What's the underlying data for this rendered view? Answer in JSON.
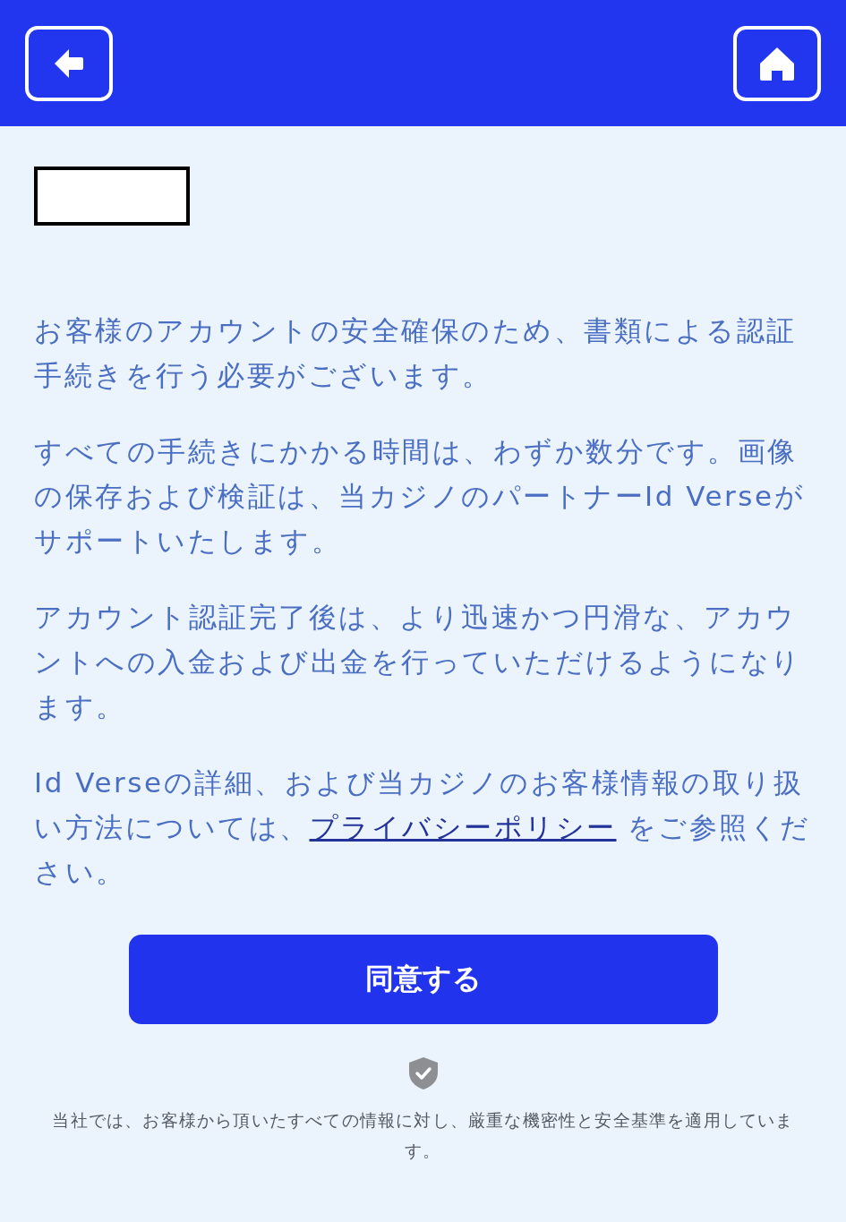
{
  "paragraphs": [
    {
      "parts": [
        {
          "text": "お客様のアカウントの安全確保のため、書類による認証手続きを行う必要がございます。",
          "kind": "plain"
        }
      ]
    },
    {
      "parts": [
        {
          "text": "すべての手続きにかかる時間は、わずか数分です。画像の保存および検証は、当カジノのパートナーId Verseがサポートいたします。",
          "kind": "plain"
        }
      ]
    },
    {
      "parts": [
        {
          "text": "アカウント認証完了後は、より迅速かつ円滑な、アカウントへの入金および出金を行っていただけるようになります。",
          "kind": "plain"
        }
      ]
    },
    {
      "parts": [
        {
          "text": "Id Verseの詳細、および当カジノのお客様情報の取り扱い方法については、",
          "kind": "plain"
        },
        {
          "text": "プライバシーポリシー",
          "kind": "link"
        },
        {
          "text": " をご参照ください。",
          "kind": "plain"
        }
      ]
    }
  ],
  "agree_button": "同意する",
  "security_note": "当社では、お客様から頂いたすべての情報に対し、厳重な機密性と安全基準を適用しています。"
}
